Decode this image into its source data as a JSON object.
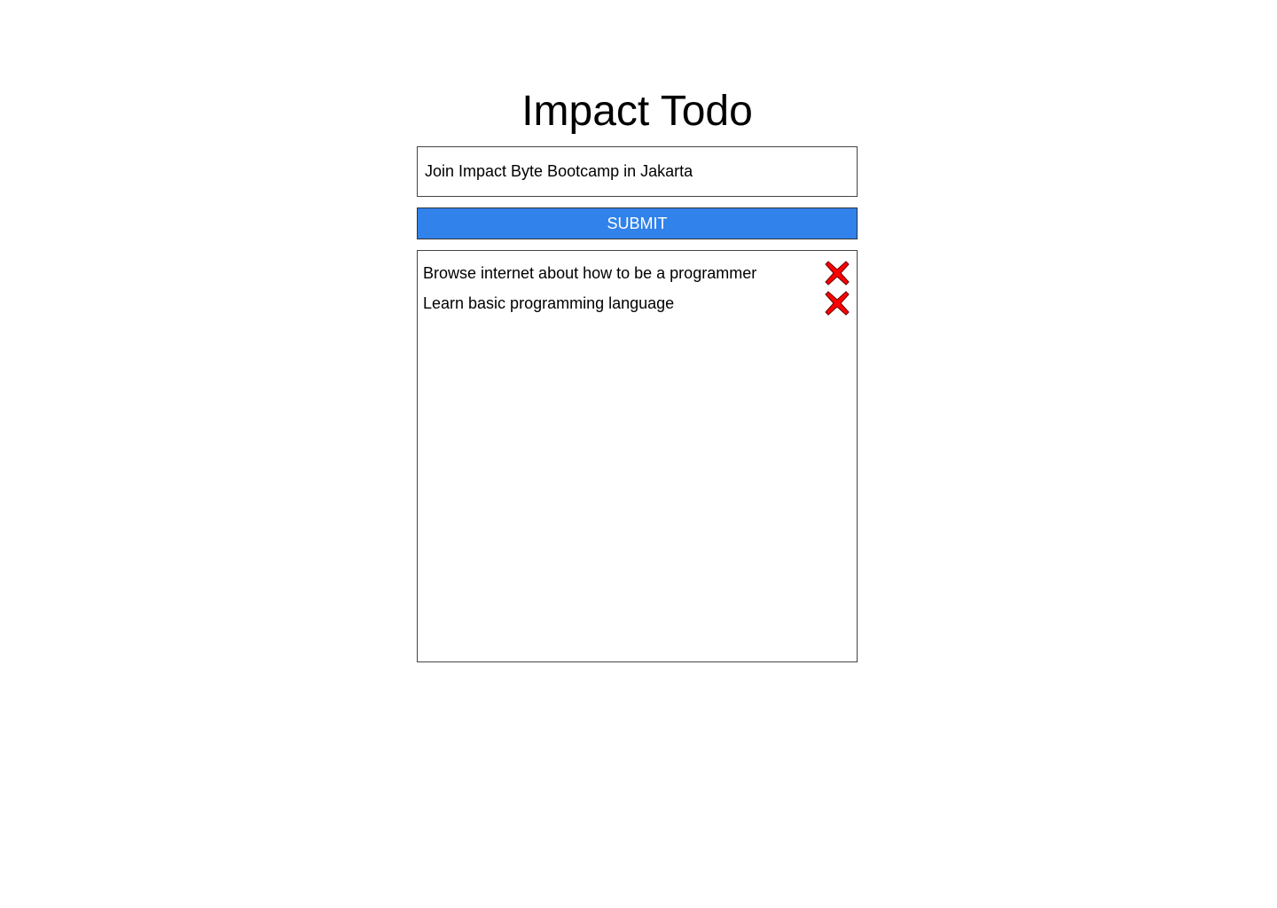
{
  "title": "Impact Todo",
  "input": {
    "value": "Join Impact Byte Bootcamp in Jakarta"
  },
  "submit_label": "SUBMIT",
  "todos": [
    {
      "text": "Browse internet about how to be a programmer",
      "icon": "delete-x-icon"
    },
    {
      "text": "Learn basic programming language",
      "icon": "delete-x-icon"
    }
  ],
  "colors": {
    "accent": "#3182ea",
    "delete": "#ff0000"
  }
}
